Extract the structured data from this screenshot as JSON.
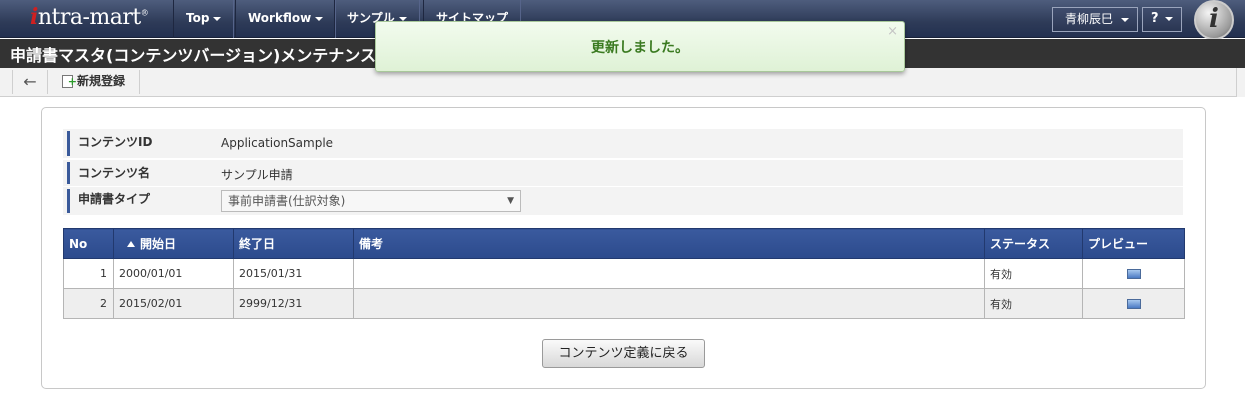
{
  "header": {
    "logo_text": "ntra-mart",
    "logo_i": "i",
    "nav": [
      {
        "label": "Top"
      },
      {
        "label": "Workflow"
      },
      {
        "label": "サンプル"
      },
      {
        "label": "サイトマップ"
      }
    ],
    "user_name": "青柳辰巳",
    "help_label": "?",
    "brand_icon_letter": "i"
  },
  "page": {
    "title": "申請書マスタ(コンテンツバージョン)メンテナンス"
  },
  "toast": {
    "message": "更新しました。",
    "close": "×"
  },
  "toolbar": {
    "back_icon": "arrow-left-icon",
    "new_label": "新規登録"
  },
  "form": {
    "content_id_label": "コンテンツID",
    "content_id_value": "ApplicationSample",
    "content_name_label": "コンテンツ名",
    "content_name_value": "サンプル申請",
    "type_label": "申請書タイプ",
    "type_value": "事前申請書(仕訳対象)"
  },
  "table": {
    "headers": {
      "no": "No",
      "start": "開始日",
      "end": "終了日",
      "note": "備考",
      "status": "ステータス",
      "preview": "プレビュー"
    },
    "rows": [
      {
        "no": "1",
        "start": "2000/01/01",
        "end": "2015/01/31",
        "note": "",
        "status": "有効"
      },
      {
        "no": "2",
        "start": "2015/02/01",
        "end": "2999/12/31",
        "note": "",
        "status": "有効"
      }
    ]
  },
  "back_button_label": "コンテンツ定義に戻る",
  "colors": {
    "nav_bg": "#2e3b58",
    "title_bg": "#333333",
    "table_header": "#2c4a8c",
    "toast_text": "#3a7a20"
  }
}
